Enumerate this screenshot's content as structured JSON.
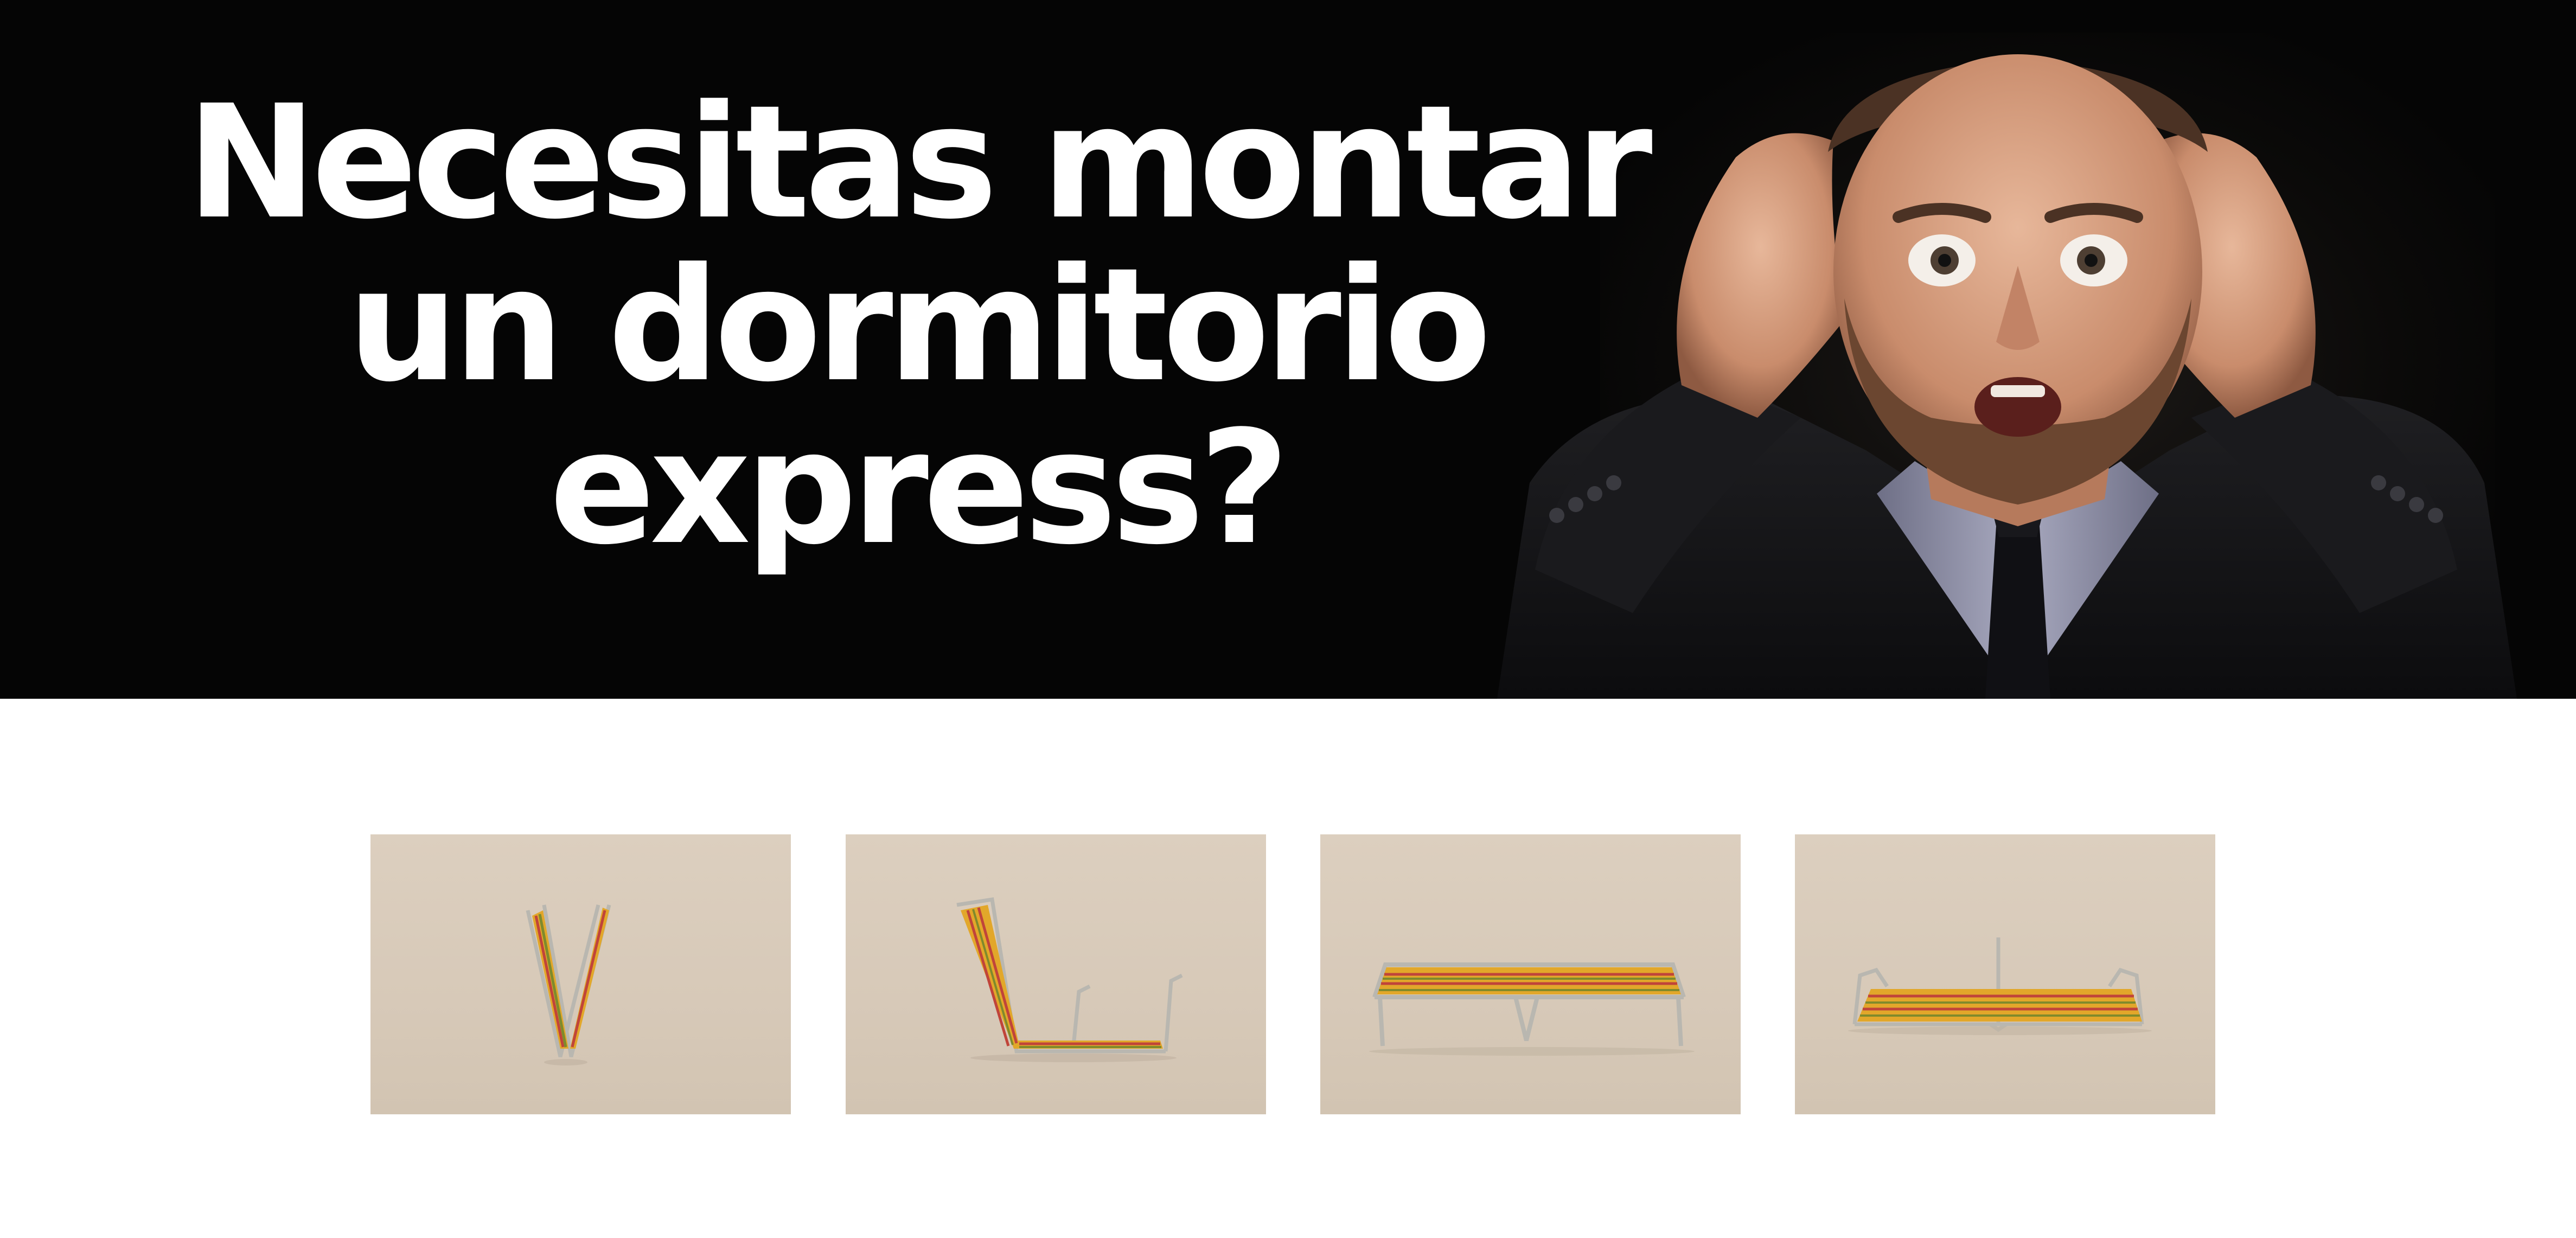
{
  "banner": {
    "headline_lines": [
      "Necesitas montar",
      "un dormitorio",
      "express?"
    ],
    "background_color": "#050505",
    "text_color": "#ffffff",
    "photo": "surprised-man-holding-head"
  },
  "gallery": {
    "background_color": "#d8cbba",
    "items": [
      {
        "name": "folding-bed-folded",
        "description_icon": "folded-cot-icon"
      },
      {
        "name": "folding-bed-half-open",
        "description_icon": "half-open-cot-icon"
      },
      {
        "name": "folding-bed-open-side",
        "description_icon": "open-cot-side-icon"
      },
      {
        "name": "folding-bed-open-front",
        "description_icon": "open-cot-front-icon"
      }
    ],
    "stripe_colors": [
      "#e2a72a",
      "#c0443a",
      "#7f8a2c"
    ]
  }
}
